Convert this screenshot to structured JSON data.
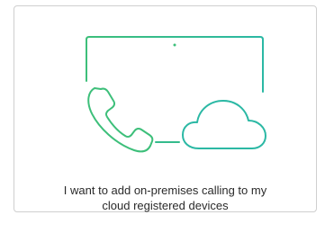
{
  "option_card": {
    "label_line1": "I want to add on-premises calling to my",
    "label_line2": "cloud registered devices"
  },
  "colors": {
    "icon_green": "#3dbf7a",
    "icon_teal": "#2bb8a4",
    "card_border": "#cfcfcf",
    "text": "#2a2a2a"
  },
  "icons": [
    "tablet-screen-icon",
    "phone-handset-icon",
    "cloud-icon"
  ]
}
